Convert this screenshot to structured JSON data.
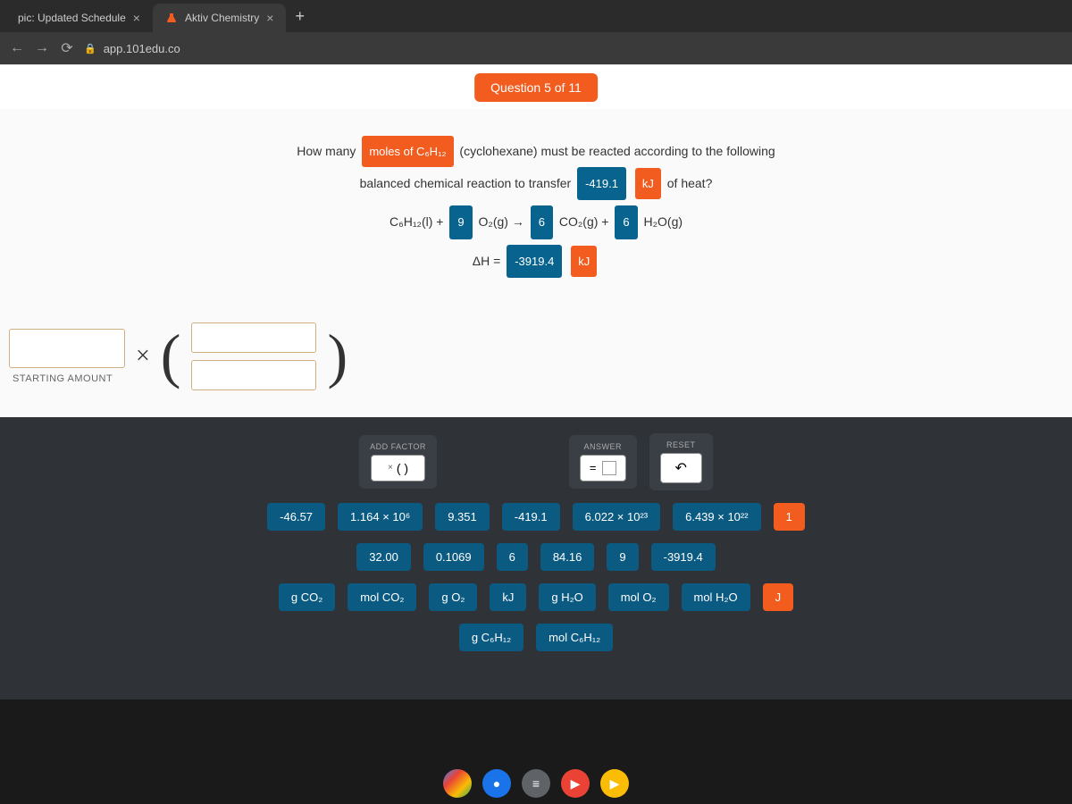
{
  "browser": {
    "tab1": "pic: Updated Schedule",
    "tab2": "Aktiv Chemistry",
    "url": "app.101edu.co"
  },
  "header": {
    "question_pill": "Question 5 of 11"
  },
  "question": {
    "l1a": "How many",
    "chip1": "moles of C₆H₁₂",
    "l1b": "(cyclohexane) must be reacted according to the following",
    "l2a": "balanced chemical reaction to transfer",
    "chip_q": "-419.1",
    "chip_kj": "kJ",
    "l2b": "of heat?",
    "eq": {
      "r1": "C₆H₁₂(l)  +",
      "c1": "9",
      "r2": "O₂(g)   →",
      "c2": "6",
      "r3": "CO₂(g)  +",
      "c3": "6",
      "r4": "H₂O(g)"
    },
    "dh_label": "ΔH =",
    "dh_val": "-3919.4",
    "dh_unit": "kJ"
  },
  "work": {
    "start_label": "STARTING AMOUNT",
    "mult": "×"
  },
  "palette": {
    "addfactor_label": "ADD FACTOR",
    "addfactor_btn": "(   )",
    "answer_label": "ANSWER",
    "answer_eq": "=",
    "reset_label": "RESET",
    "undo": "↶",
    "row1": [
      "-46.57",
      "1.164 × 10⁶",
      "9.351",
      "-419.1",
      "6.022 × 10²³",
      "6.439 × 10²²",
      "1"
    ],
    "row2": [
      "32.00",
      "0.1069",
      "6",
      "84.16",
      "9",
      "-3919.4"
    ],
    "row3": [
      "g CO₂",
      "mol CO₂",
      "g O₂",
      "kJ",
      "g H₂O",
      "mol O₂",
      "mol H₂O",
      "J"
    ],
    "row4": [
      "g C₆H₁₂",
      "mol C₆H₁₂"
    ]
  },
  "chart_data": null
}
